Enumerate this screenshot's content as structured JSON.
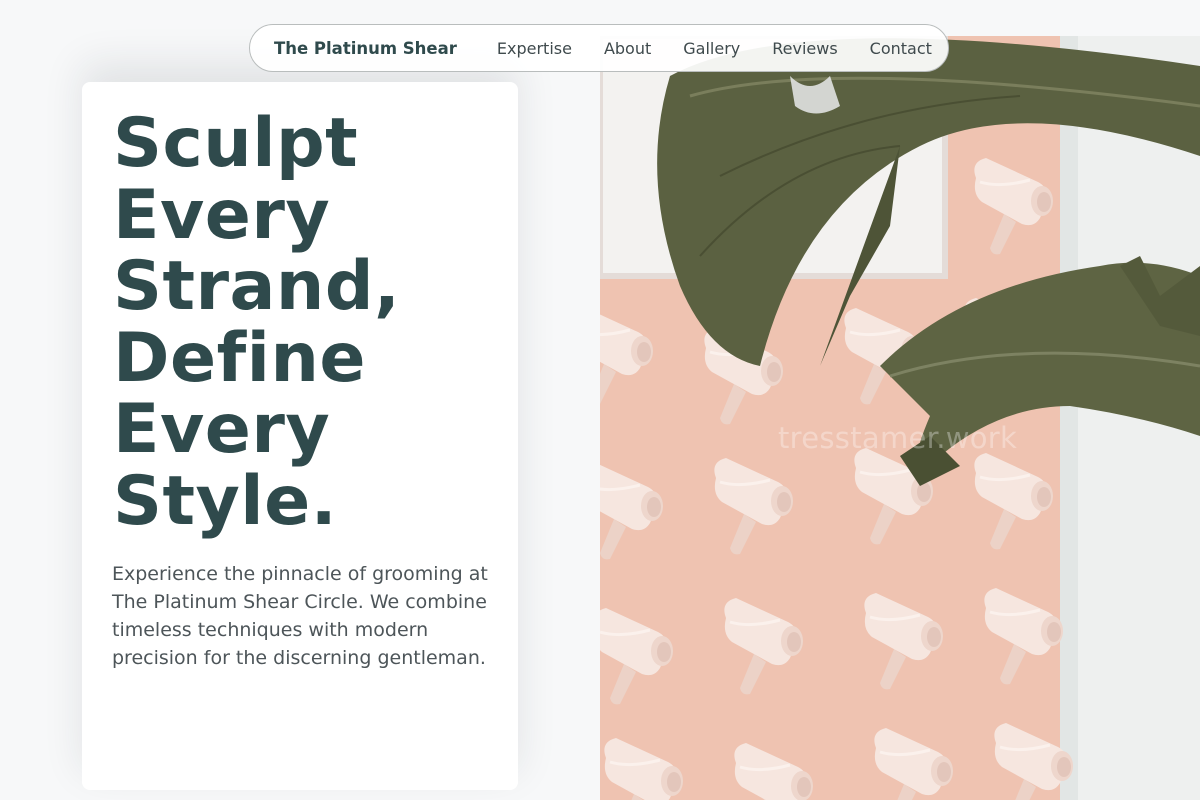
{
  "nav": {
    "brand": "The Platinum Shear",
    "links": [
      "Expertise",
      "About",
      "Gallery",
      "Reviews",
      "Contact"
    ]
  },
  "hero": {
    "title": "Sculpt Every Strand, Define Every Style.",
    "description": "Experience the pinnacle of grooming at The Platinum Shear Circle. We combine timeless techniques with modern precision for the discerning gentleman.",
    "image_watermark": "tresstamer.work"
  },
  "colors": {
    "primary": "#2f4a4c",
    "body_text": "#4d5559",
    "page_bg": "#f7f8f9",
    "wall_pink": "#f0c4b2",
    "dryer": "#f4e1d9",
    "leaf": "#5a6140"
  },
  "icons": {
    "image_subject": "hair-dryer-wall-with-banana-leaves"
  }
}
